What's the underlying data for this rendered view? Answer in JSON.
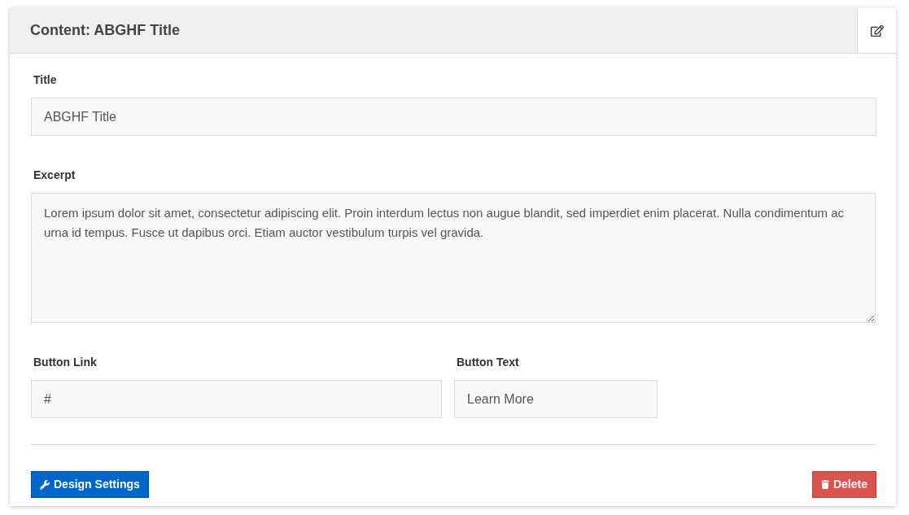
{
  "panel": {
    "title": "Content: ABGHF Title"
  },
  "fields": {
    "title": {
      "label": "Title",
      "value": "ABGHF Title"
    },
    "excerpt": {
      "label": "Excerpt",
      "value": "Lorem ipsum dolor sit amet, consectetur adipiscing elit. Proin interdum lectus non augue blandit, sed imperdiet enim placerat. Nulla condimentum ac urna id tempus. Fusce ut dapibus orci. Etiam auctor vestibulum turpis vel gravida."
    },
    "button_link": {
      "label": "Button Link",
      "value": "#"
    },
    "button_text": {
      "label": "Button Text",
      "value": "Learn More"
    }
  },
  "actions": {
    "design_settings": "Design Settings",
    "delete": "Delete"
  }
}
